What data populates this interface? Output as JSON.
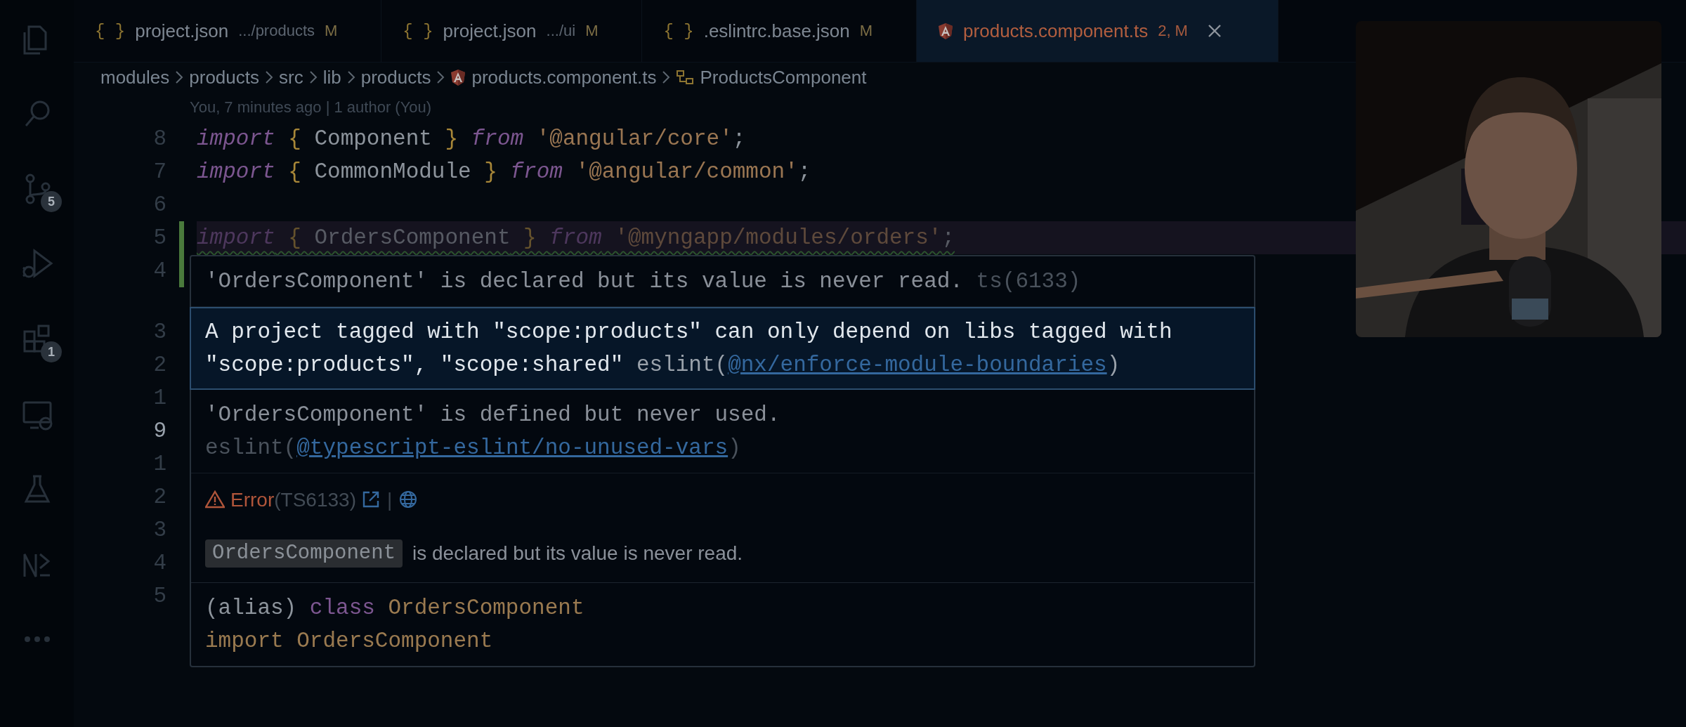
{
  "activity_bar": {
    "items": [
      {
        "kind": "files"
      },
      {
        "kind": "search"
      },
      {
        "kind": "source-control",
        "badge": "5"
      },
      {
        "kind": "run-debug"
      },
      {
        "kind": "extensions",
        "badge": "1"
      },
      {
        "kind": "remote"
      },
      {
        "kind": "testing"
      },
      {
        "kind": "nx"
      },
      {
        "kind": "more"
      }
    ]
  },
  "tabs": [
    {
      "kind": "json",
      "icon": "{ }",
      "name": "project.json",
      "path": ".../products",
      "badge": "M",
      "selected": false
    },
    {
      "kind": "json",
      "icon": "{ }",
      "name": "project.json",
      "path": ".../ui",
      "badge": "M",
      "selected": false
    },
    {
      "kind": "json",
      "icon": "{ }",
      "name": ".eslintrc.base.json",
      "badge": "M",
      "selected": false
    },
    {
      "kind": "angular",
      "name": "products.component.ts",
      "badge": "2, M",
      "selected": true
    }
  ],
  "breadcrumbs": [
    {
      "kind": "folder",
      "text": "modules"
    },
    {
      "kind": "folder",
      "text": "products"
    },
    {
      "kind": "folder",
      "text": "src"
    },
    {
      "kind": "folder",
      "text": "lib"
    },
    {
      "kind": "folder",
      "text": "products"
    },
    {
      "kind": "angular-file",
      "text": "products.component.ts"
    },
    {
      "kind": "class",
      "text": "ProductsComponent"
    }
  ],
  "blame": "You, 7 minutes ago | 1 author (You)",
  "gutter": {
    "lines": [
      {
        "number": "8",
        "modified": false,
        "current": false,
        "unused": false,
        "tokens": [
          {
            "kind": "keyword",
            "text": "import"
          },
          {
            "kind": "punct",
            "text": " { "
          },
          {
            "kind": "name",
            "text": "Component"
          },
          {
            "kind": "punct",
            "text": " } "
          },
          {
            "kind": "keyword",
            "text": "from"
          },
          {
            "kind": "string",
            "text": " '@angular/core'"
          },
          {
            "kind": "plain",
            "text": ";"
          }
        ]
      },
      {
        "number": "7",
        "modified": false,
        "current": false,
        "unused": false,
        "tokens": [
          {
            "kind": "keyword",
            "text": "import"
          },
          {
            "kind": "punct",
            "text": " { "
          },
          {
            "kind": "name",
            "text": "CommonModule"
          },
          {
            "kind": "punct",
            "text": " } "
          },
          {
            "kind": "keyword",
            "text": "from"
          },
          {
            "kind": "string",
            "text": " '@angular/common'"
          },
          {
            "kind": "plain",
            "text": ";"
          }
        ]
      },
      {
        "number": "6",
        "modified": false,
        "current": false
      },
      {
        "number": "5",
        "modified": true,
        "current": false,
        "unused": true,
        "tokens": [
          {
            "kind": "keyword",
            "text": "import"
          },
          {
            "kind": "punct",
            "text": " { "
          },
          {
            "kind": "name",
            "text": "OrdersComponent"
          },
          {
            "kind": "punct",
            "text": " } "
          },
          {
            "kind": "keyword",
            "text": "from"
          },
          {
            "kind": "string",
            "text": " '@myngapp/modules/orders'"
          },
          {
            "kind": "plain",
            "text": ";"
          }
        ]
      },
      {
        "number": "4",
        "modified": true,
        "current": false
      },
      {
        "number": "3",
        "modified": false,
        "current": false
      },
      {
        "number": "2",
        "modified": false,
        "current": false
      },
      {
        "number": "1",
        "modified": false,
        "current": false
      },
      {
        "number": "9",
        "modified": false,
        "current": true
      },
      {
        "number": "1",
        "modified": false,
        "current": false
      },
      {
        "number": "2",
        "modified": false,
        "current": false
      },
      {
        "number": "3",
        "modified": false,
        "current": false
      },
      {
        "number": "4",
        "modified": false,
        "current": false
      },
      {
        "number": "5",
        "modified": false,
        "current": false
      }
    ]
  },
  "hover": {
    "diagnostics": [
      {
        "message": "'OrdersComponent' is declared but its value is never read.",
        "source": "ts(6133)",
        "selected": false
      },
      {
        "message": "A project tagged with \"scope:products\" can only depend on libs tagged with \"scope:products\", \"scope:shared\"",
        "source": "eslint(",
        "link": "@nx/enforce-module-boundaries",
        "source_end": ")",
        "selected": true
      },
      {
        "message": "'OrdersComponent' is defined but never used.",
        "source": "eslint(",
        "link": "@typescript-eslint/no-unused-vars",
        "source_end": ")",
        "selected": false
      }
    ],
    "error": {
      "severity": "Error",
      "code": "(TS6133)",
      "separator": "|"
    },
    "description": {
      "code": "OrdersComponent",
      "text": "is declared but its value is never read."
    },
    "signature": [
      [
        {
          "kind": "plain",
          "text": "(alias) "
        },
        {
          "kind": "storage",
          "text": "class"
        },
        {
          "kind": "type",
          "text": " OrdersComponent"
        }
      ],
      [
        {
          "kind": "type",
          "text": "import OrdersComponent"
        }
      ]
    ]
  }
}
